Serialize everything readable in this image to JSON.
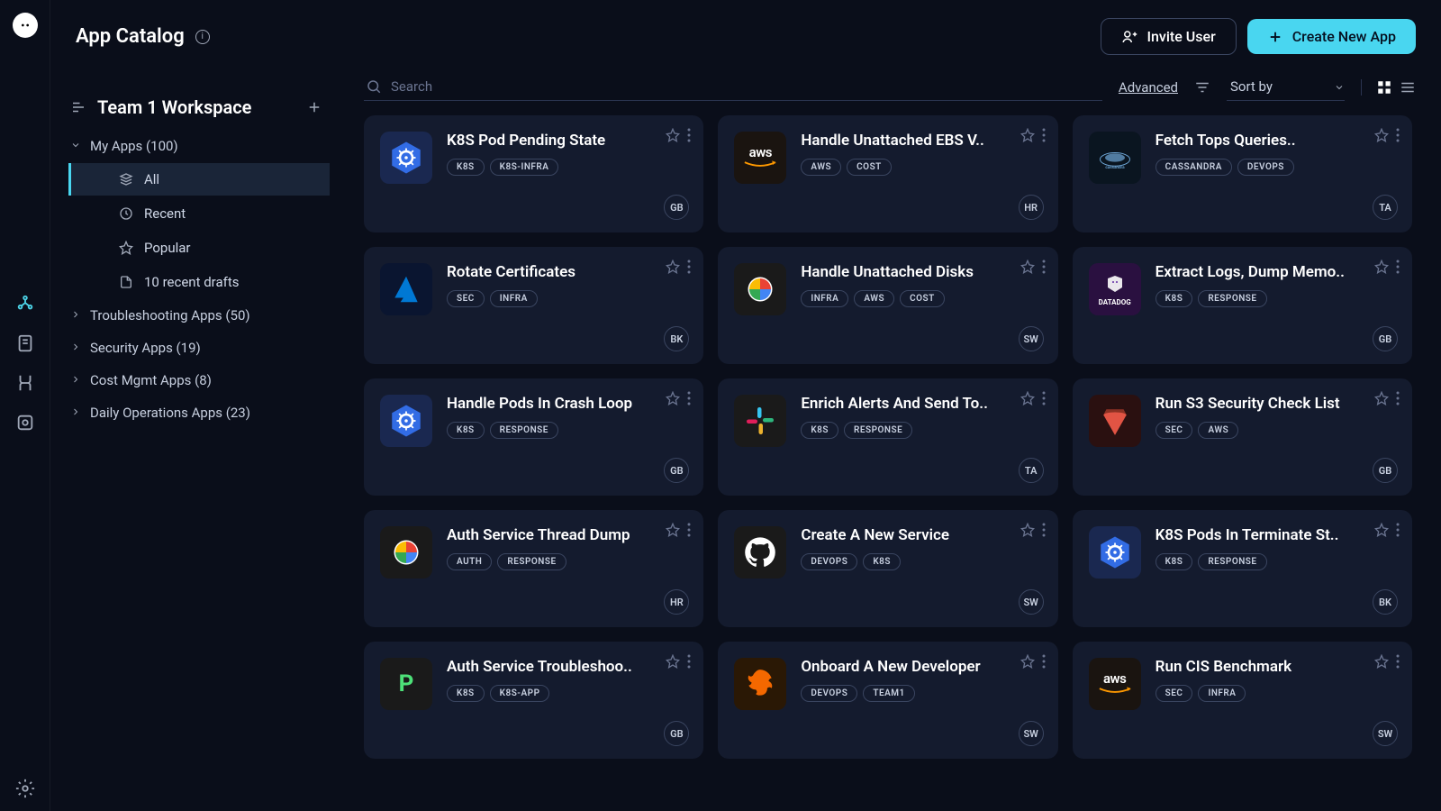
{
  "header": {
    "title": "App Catalog",
    "invite_label": "Invite User",
    "create_label": "Create New App"
  },
  "search": {
    "placeholder": "Search",
    "advanced": "Advanced",
    "sort_label": "Sort by"
  },
  "workspace": {
    "title": "Team 1 Workspace"
  },
  "sidebar": {
    "groups": [
      {
        "label": "My Apps (100)",
        "expanded": true
      },
      {
        "label": "Troubleshooting Apps (50)",
        "expanded": false
      },
      {
        "label": "Security Apps (19)",
        "expanded": false
      },
      {
        "label": "Cost Mgmt Apps (8)",
        "expanded": false
      },
      {
        "label": "Daily Operations Apps (23)",
        "expanded": false
      }
    ],
    "my_apps_children": [
      {
        "label": "All",
        "icon": "stack",
        "active": true
      },
      {
        "label": "Recent",
        "icon": "clock",
        "active": false
      },
      {
        "label": "Popular",
        "icon": "star",
        "active": false
      },
      {
        "label": "10 recent drafts",
        "icon": "file",
        "active": false
      }
    ]
  },
  "apps": [
    {
      "title": "K8S Pod Pending State",
      "tags": [
        "K8S",
        "K8S-INFRA"
      ],
      "logo": "k8s",
      "avatar": "GB"
    },
    {
      "title": "Handle Unattached EBS V..",
      "tags": [
        "AWS",
        "COST"
      ],
      "logo": "aws",
      "avatar": "HR"
    },
    {
      "title": "Fetch Tops Queries..",
      "tags": [
        "CASSANDRA",
        "DEVOPS"
      ],
      "logo": "cassandra",
      "avatar": "TA"
    },
    {
      "title": "Rotate Certificates",
      "tags": [
        "SEC",
        "INFRA"
      ],
      "logo": "azure",
      "avatar": "BK"
    },
    {
      "title": "Handle Unattached Disks",
      "tags": [
        "INFRA",
        "AWS",
        "COST"
      ],
      "logo": "gcp",
      "avatar": "SW"
    },
    {
      "title": "Extract Logs, Dump Memo..",
      "tags": [
        "K8S",
        "RESPONSE"
      ],
      "logo": "datadog",
      "avatar": "GB"
    },
    {
      "title": "Handle Pods In Crash Loop",
      "tags": [
        "K8S",
        "RESPONSE"
      ],
      "logo": "k8s",
      "avatar": "GB"
    },
    {
      "title": "Enrich Alerts And Send To..",
      "tags": [
        "K8S",
        "RESPONSE"
      ],
      "logo": "slack",
      "avatar": "TA"
    },
    {
      "title": "Run S3 Security Check List",
      "tags": [
        "SEC",
        "AWS"
      ],
      "logo": "s3",
      "avatar": "GB"
    },
    {
      "title": "Auth Service Thread Dump",
      "tags": [
        "AUTH",
        "RESPONSE"
      ],
      "logo": "gcp",
      "avatar": "HR"
    },
    {
      "title": "Create A New Service",
      "tags": [
        "DEVOPS",
        "K8S"
      ],
      "logo": "github",
      "avatar": "SW"
    },
    {
      "title": "K8S Pods In Terminate St..",
      "tags": [
        "K8S",
        "RESPONSE"
      ],
      "logo": "k8s",
      "avatar": "BK"
    },
    {
      "title": "Auth Service Troubleshoo..",
      "tags": [
        "K8S",
        "K8S-APP"
      ],
      "logo": "p",
      "avatar": "GB"
    },
    {
      "title": "Onboard A New Developer",
      "tags": [
        "DEVOPS",
        "TEAM1"
      ],
      "logo": "grafana",
      "avatar": "SW"
    },
    {
      "title": "Run CIS Benchmark",
      "tags": [
        "SEC",
        "INFRA"
      ],
      "logo": "aws",
      "avatar": "SW"
    }
  ]
}
